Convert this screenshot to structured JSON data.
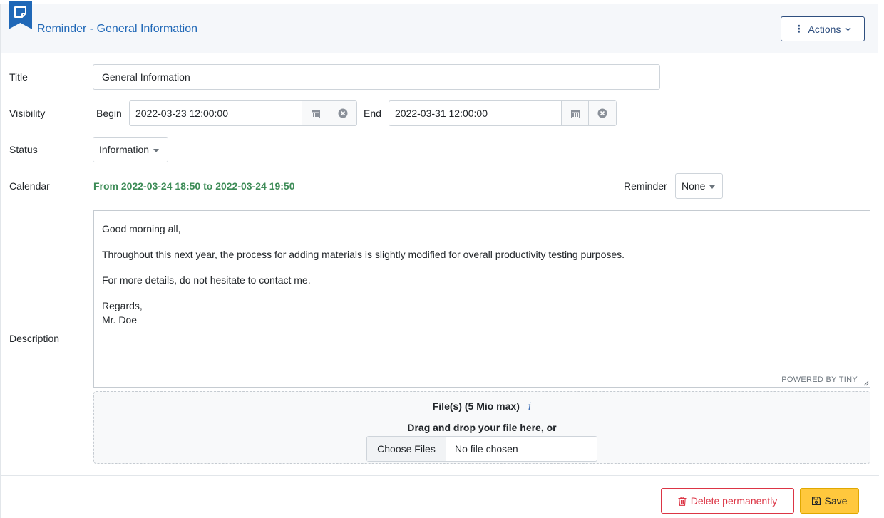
{
  "header": {
    "title": "Reminder - General Information",
    "actions_label": "Actions",
    "accent_color": "#2068b7"
  },
  "fields": {
    "title_label": "Title",
    "title_value": "General Information",
    "visibility_label": "Visibility",
    "begin_label": "Begin",
    "begin_value": "2022-03-23 12:00:00",
    "end_label": "End",
    "end_value": "2022-03-31 12:00:00",
    "status_label": "Status",
    "status_value": "Information",
    "calendar_label": "Calendar",
    "calendar_text": "From 2022-03-24 18:50 to 2022-03-24 19:50",
    "reminder_label": "Reminder",
    "reminder_value": "None",
    "description_label": "Description"
  },
  "description": {
    "line1": "Good morning all,",
    "line2": "Throughout this next year, the process for adding materials is slightly modified for overall productivity testing purposes.",
    "line3": "For more details, do not hesitate to contact me.",
    "line4": "Regards,",
    "line5": "Mr. Doe",
    "powered": "POWERED BY TINY"
  },
  "upload": {
    "title": "File(s) (5 Mio max)",
    "info": "i",
    "drag_text": "Drag and drop your file here, or",
    "choose_label": "Choose Files",
    "no_file": "No file chosen"
  },
  "footer": {
    "delete_label": "Delete permanently",
    "save_label": "Save",
    "delete_color": "#dc3545",
    "save_color": "#ffc83d"
  }
}
